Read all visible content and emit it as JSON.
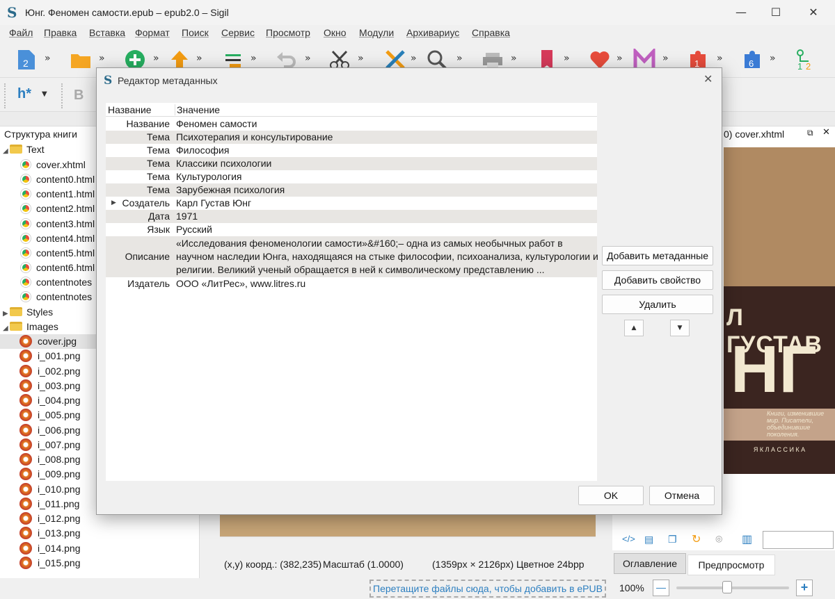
{
  "window": {
    "title": "Юнг. Феномен самости.epub – epub2.0 – Sigil",
    "icon": "S",
    "minimize": "—",
    "maximize": "☐",
    "close": "✕"
  },
  "menu": [
    "Файл",
    "Правка",
    "Вставка",
    "Формат",
    "Поиск",
    "Сервис",
    "Просмотр",
    "Окно",
    "Модули",
    "Архивариус",
    "Справка"
  ],
  "toolbar": {
    "chev": "»",
    "badge_1": "1",
    "badge_6": "6",
    "heading": "h*",
    "bold": "B"
  },
  "book_browser": {
    "title": "Структура книги",
    "text_folder": "Text",
    "text_files": [
      "cover.xhtml",
      "content0.html",
      "content1.html",
      "content2.html",
      "content3.html",
      "content4.html",
      "content5.html",
      "content6.html",
      "contentnotes",
      "contentnotes"
    ],
    "styles_folder": "Styles",
    "images_folder": "Images",
    "image_files": [
      "cover.jpg",
      "i_001.png",
      "i_002.png",
      "i_003.png",
      "i_004.png",
      "i_005.png",
      "i_006.png",
      "i_007.png",
      "i_008.png",
      "i_009.png",
      "i_010.png",
      "i_011.png",
      "i_012.png",
      "i_013.png",
      "i_014.png",
      "i_015.png"
    ]
  },
  "preview": {
    "tab_title": "0) cover.xhtml",
    "cover_line1": "Л ГУСТАВ",
    "cover_line2": "НГ",
    "cover_tagline": "Книги, изменившие мир. Писатели, объединившие поколения.",
    "cover_series": "Я  К Л А С С И К А",
    "tab_toc": "Оглавление",
    "tab_preview": "Предпросмотр",
    "zoom": "100%",
    "zoom_out": "—",
    "zoom_in": "+",
    "zoom_level": 0.45
  },
  "status": {
    "coords": "(x,y) коорд.: (382,235)",
    "scale": "Масштаб (1.0000)",
    "size": "(1359px × 2126px) Цветное 24bpp",
    "drop_hint": "Перетащите файлы сюда, чтобы добавить в ePUB"
  },
  "dialog": {
    "title": "Редактор метаданных",
    "close": "✕",
    "col_name": "Название",
    "col_value": "Значение",
    "rows": [
      {
        "name": "Название",
        "value": "Феномен самости"
      },
      {
        "name": "Тема",
        "value": "Психотерапия и консультирование"
      },
      {
        "name": "Тема",
        "value": "Философия"
      },
      {
        "name": "Тема",
        "value": "Классики психологии"
      },
      {
        "name": "Тема",
        "value": "Культурология"
      },
      {
        "name": "Тема",
        "value": "Зарубежная психология"
      },
      {
        "name": "Создатель",
        "value": "Карл Густав Юнг"
      },
      {
        "name": "Дата",
        "value": "1971"
      },
      {
        "name": "Язык",
        "value": "Русский"
      },
      {
        "name": "Описание",
        "value_lines": [
          "«Исследования феноменологии самости»&#160;– одна из самых необычных работ в",
          "научном наследии Юнга, находящаяся на стыке философии, психоанализа, культурологии и",
          "религии. Великий ученый обращается в ней к символическому представлению ..."
        ]
      },
      {
        "name": "Издатель",
        "value": "ООО «ЛитРес», www.litres.ru"
      }
    ],
    "btn_add_metadata": "Добавить метаданные",
    "btn_add_property": "Добавить свойство",
    "btn_delete": "Удалить",
    "btn_up": "▲",
    "btn_down": "▼",
    "btn_ok": "OK",
    "btn_cancel": "Отмена"
  }
}
